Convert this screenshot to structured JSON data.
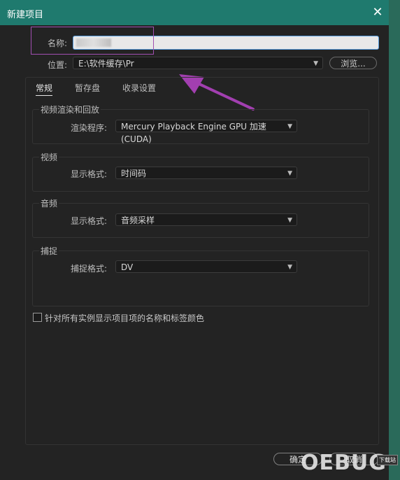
{
  "window": {
    "title": "新建项目",
    "close_glyph": "✕"
  },
  "name": {
    "label": "名称:",
    "value": ""
  },
  "location": {
    "label": "位置:",
    "value": "E:\\软件缓存\\Pr",
    "browse_label": "浏览..."
  },
  "tabs": [
    {
      "label": "常规",
      "active": true
    },
    {
      "label": "暂存盘",
      "active": false
    },
    {
      "label": "收录设置",
      "active": false
    }
  ],
  "groups": {
    "video_render": {
      "title": "视频渲染和回放",
      "field_label": "渲染程序:",
      "value": "Mercury Playback Engine GPU 加速 (CUDA)"
    },
    "video": {
      "title": "视频",
      "field_label": "显示格式:",
      "value": "时间码"
    },
    "audio": {
      "title": "音频",
      "field_label": "显示格式:",
      "value": "音频采样"
    },
    "capture": {
      "title": "捕捉",
      "field_label": "捕捉格式:",
      "value": "DV"
    }
  },
  "checkbox": {
    "label": "针对所有实例显示项目项的名称和标签颜色",
    "checked": false
  },
  "buttons": {
    "ok": "确定",
    "cancel": "取消"
  },
  "watermark": {
    "text": "OEBUG",
    "badge": "下载站"
  },
  "colors": {
    "titlebar": "#1f7a6e",
    "highlight": "#a24fb2",
    "arrow": "#a23fb0"
  }
}
